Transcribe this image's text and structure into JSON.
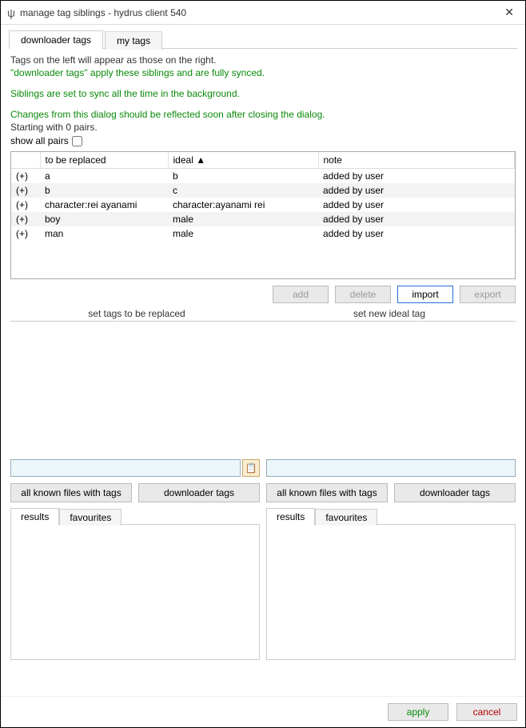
{
  "window": {
    "title": "manage tag siblings - hydrus client 540",
    "icon": "ψ"
  },
  "top_tabs": {
    "active": "downloader tags",
    "inactive": "my tags"
  },
  "info": {
    "line1": "Tags on the left will appear as those on the right.",
    "line2": "\"downloader tags\" apply these siblings and are fully synced.",
    "line3": "Siblings are set to sync all the time in the background.",
    "line4": "Changes from this dialog should be reflected soon after closing the dialog.",
    "line5": "Starting with 0 pairs."
  },
  "show_all_pairs_label": "show all pairs",
  "table": {
    "headers": {
      "mark": "",
      "replaced": "to be replaced",
      "ideal": "ideal ▲",
      "note": "note"
    },
    "rows": [
      {
        "mark": "(+)",
        "replaced": "a",
        "ideal": "b",
        "note": "added by user"
      },
      {
        "mark": "(+)",
        "replaced": "b",
        "ideal": "c",
        "note": "added by user"
      },
      {
        "mark": "(+)",
        "replaced": "character:rei ayanami",
        "ideal": "character:ayanami rei",
        "note": "added by user"
      },
      {
        "mark": "(+)",
        "replaced": "boy",
        "ideal": "male",
        "note": "added by user"
      },
      {
        "mark": "(+)",
        "replaced": "man",
        "ideal": "male",
        "note": "added by user"
      }
    ]
  },
  "buttons": {
    "add": "add",
    "delete": "delete",
    "import": "import",
    "export": "export"
  },
  "panel_headers": {
    "left": "set tags to be replaced",
    "right": "set new ideal tag"
  },
  "left_panel": {
    "filter_files": "all known files with tags",
    "filter_tags": "downloader tags",
    "tab_results": "results",
    "tab_favourites": "favourites"
  },
  "right_panel": {
    "filter_files": "all known files with tags",
    "filter_tags": "downloader tags",
    "tab_results": "results",
    "tab_favourites": "favourites"
  },
  "footer": {
    "apply": "apply",
    "cancel": "cancel"
  }
}
